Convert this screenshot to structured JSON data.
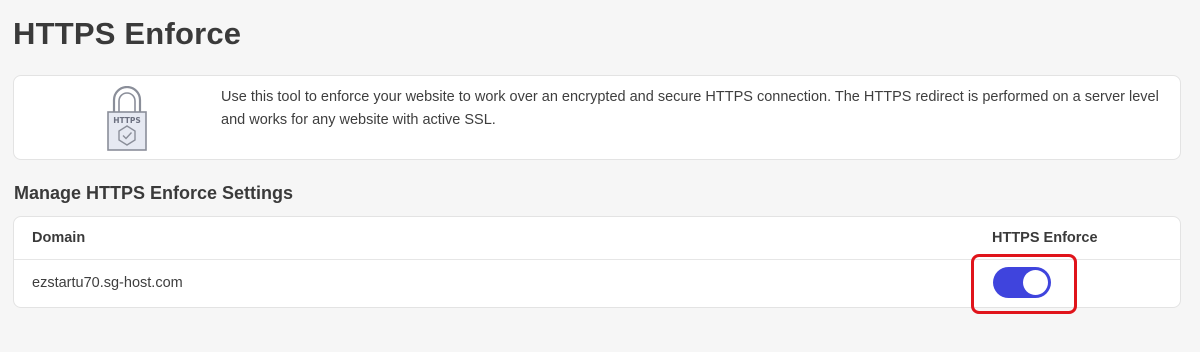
{
  "page": {
    "title": "HTTPS Enforce"
  },
  "info": {
    "icon": "lock-https-icon",
    "icon_label": "HTTPS",
    "description": "Use this tool to enforce your website to work over an encrypted and secure HTTPS connection. The HTTPS redirect is performed on a server level and works for any website with active SSL."
  },
  "settings": {
    "title": "Manage HTTPS Enforce Settings",
    "columns": {
      "domain": "Domain",
      "enforce": "HTTPS Enforce"
    },
    "rows": [
      {
        "domain": "ezstartu70.sg-host.com",
        "enforce_enabled": true
      }
    ]
  },
  "colors": {
    "accent": "#3f44dd",
    "highlight": "#e0141b"
  }
}
